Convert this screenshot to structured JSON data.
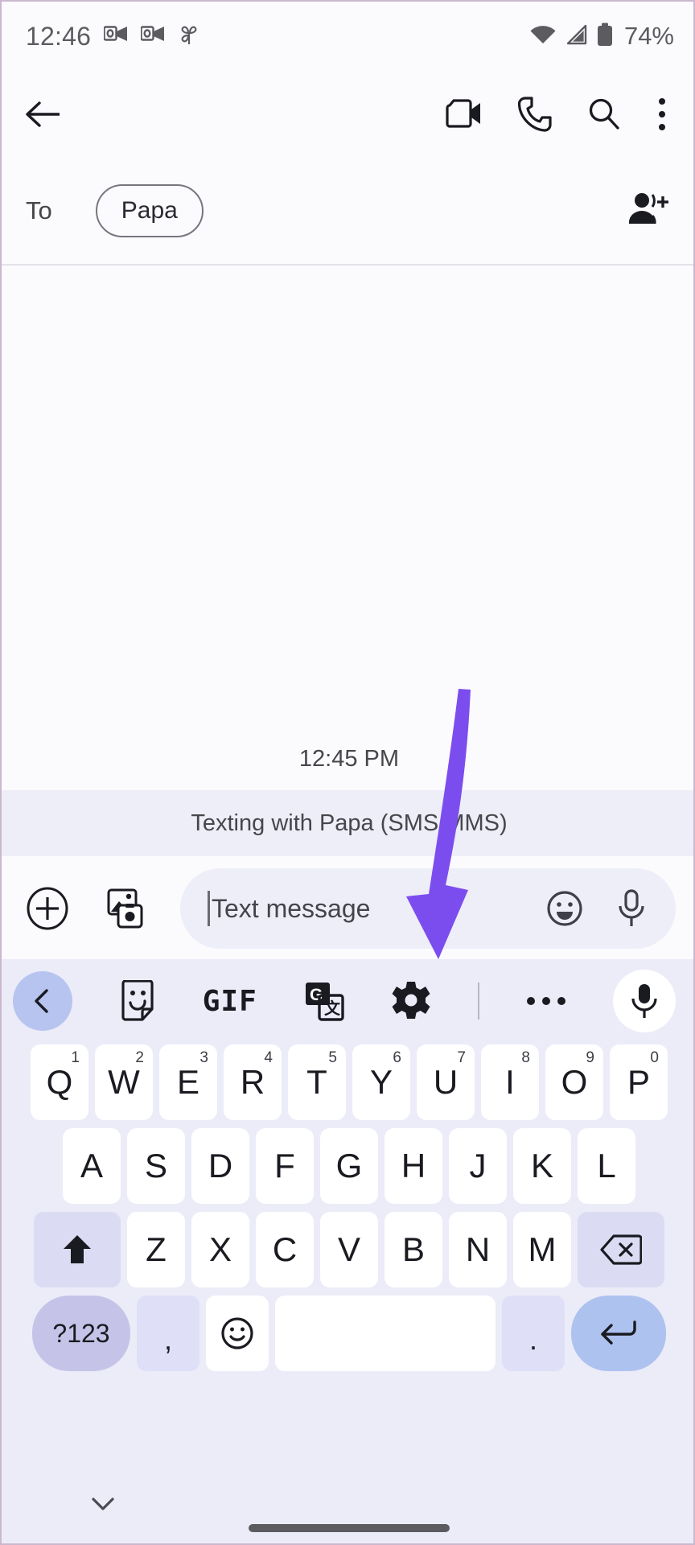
{
  "status_bar": {
    "time": "12:46",
    "battery_percent": "74%",
    "left_icons": [
      "outlook-icon",
      "outlook-icon",
      "pinwheel-icon"
    ],
    "right_icons": [
      "wifi-icon",
      "cellular-signal-icon",
      "battery-icon"
    ]
  },
  "app_bar": {
    "back_icon": "back-arrow-icon",
    "actions": [
      "video-call-icon",
      "phone-call-icon",
      "search-icon",
      "overflow-menu-icon"
    ]
  },
  "recipient_row": {
    "to_label": "To",
    "chip_label": "Papa",
    "add_person_icon": "add-person-icon"
  },
  "conversation": {
    "timestamp": "12:45 PM",
    "sms_banner": "Texting with Papa (SMS/MMS)"
  },
  "composer": {
    "plus_icon": "plus-circle-icon",
    "gallery_icon": "gallery-icon",
    "placeholder": "Text message",
    "value": "",
    "emoji_icon": "emoji-face-icon",
    "mic_icon": "microphone-icon"
  },
  "keyboard_toolbar": {
    "back_chevron_icon": "chevron-left-icon",
    "sticker_icon": "sticker-icon",
    "gif_label": "GIF",
    "translate_icon": "google-translate-icon",
    "settings_icon": "gear-icon",
    "more_icon": "more-horizontal-icon",
    "mic_icon": "microphone-icon"
  },
  "keyboard": {
    "row1": [
      {
        "label": "Q",
        "sup": "1"
      },
      {
        "label": "W",
        "sup": "2"
      },
      {
        "label": "E",
        "sup": "3"
      },
      {
        "label": "R",
        "sup": "4"
      },
      {
        "label": "T",
        "sup": "5"
      },
      {
        "label": "Y",
        "sup": "6"
      },
      {
        "label": "U",
        "sup": "7"
      },
      {
        "label": "I",
        "sup": "8"
      },
      {
        "label": "O",
        "sup": "9"
      },
      {
        "label": "P",
        "sup": "0"
      }
    ],
    "row2": [
      "A",
      "S",
      "D",
      "F",
      "G",
      "H",
      "J",
      "K",
      "L"
    ],
    "row3": {
      "shift_icon": "shift-arrow-icon",
      "letters": [
        "Z",
        "X",
        "C",
        "V",
        "B",
        "N",
        "M"
      ],
      "backspace_icon": "backspace-icon"
    },
    "row4": {
      "symbols_label": "?123",
      "comma_label": ",",
      "emoji_icon": "emoji-face-icon",
      "space_label": "",
      "period_label": ".",
      "enter_icon": "enter-return-icon"
    }
  },
  "nav_bar": {
    "hide_keyboard_icon": "chevron-down-icon",
    "home_indicator": "home-gesture-bar"
  },
  "annotation": {
    "arrow_icon": "down-arrow-annotation",
    "color": "#7C4DEE",
    "points_to": "gear-icon"
  },
  "colors": {
    "page_background": "#fbfafd",
    "keyboard_background": "#ebecf8",
    "banner_background": "#edeef8",
    "key_white": "#ffffff",
    "key_lavender": "#dbdcf4",
    "enter_blue": "#aec2f0",
    "accent_purple": "#7C4DEE"
  }
}
